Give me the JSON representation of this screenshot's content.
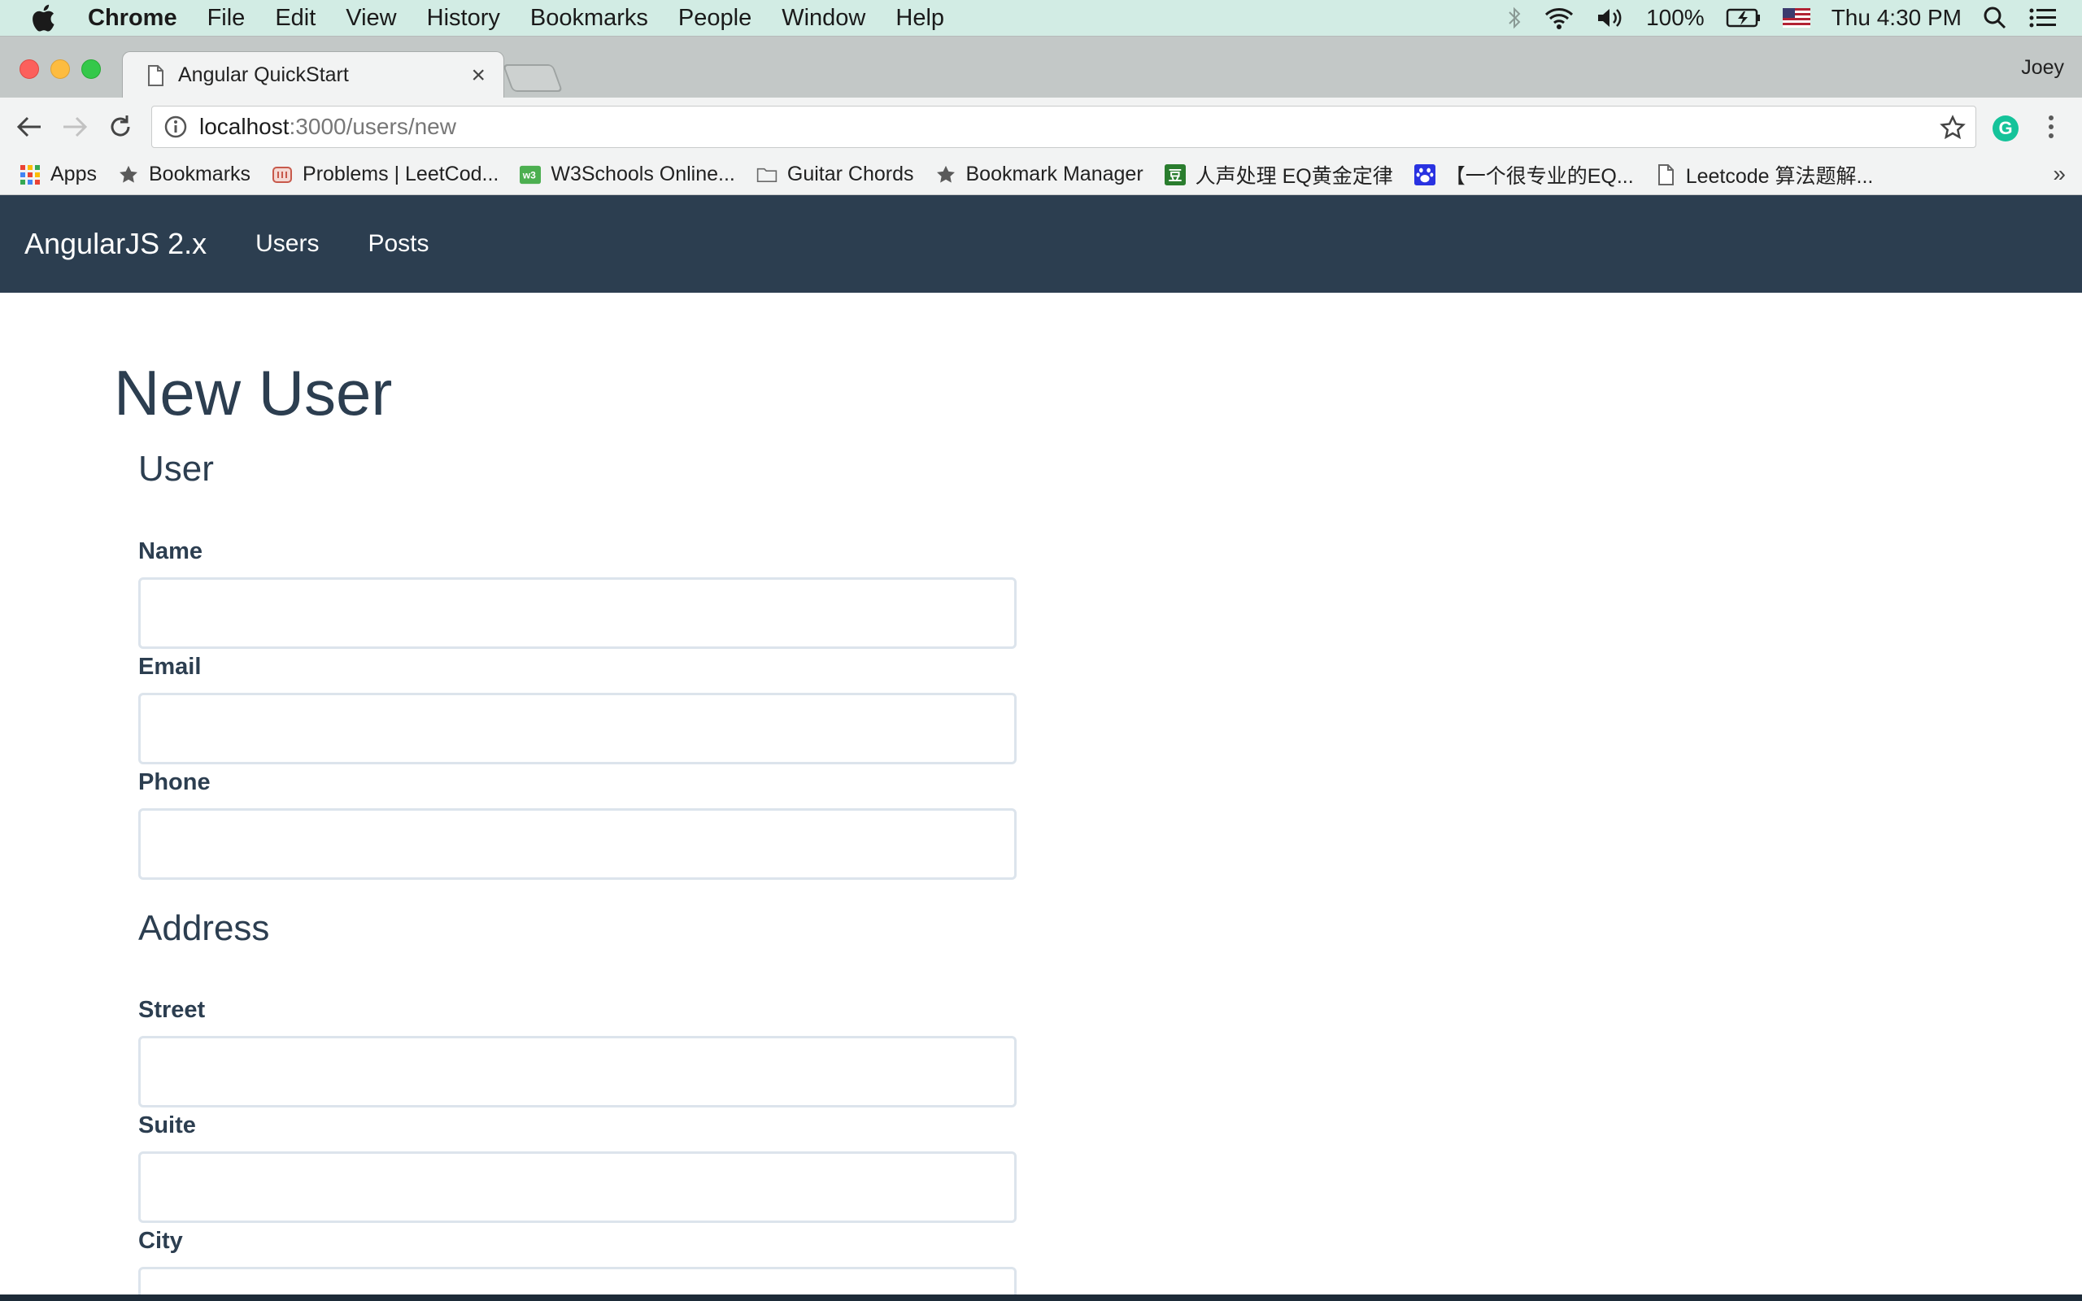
{
  "menubar": {
    "app_name": "Chrome",
    "items": [
      "File",
      "Edit",
      "View",
      "History",
      "Bookmarks",
      "People",
      "Window",
      "Help"
    ],
    "battery": "100%",
    "clock": "Thu 4:30 PM"
  },
  "browser": {
    "tab_title": "Angular QuickStart",
    "tab_close": "×",
    "profile_name": "Joey",
    "url_host": "localhost",
    "url_path": ":3000/users/new",
    "extension_letter": "G"
  },
  "bookmarks": {
    "items": [
      {
        "label": "Apps",
        "icon": "apps-grid-icon"
      },
      {
        "label": "Bookmarks",
        "icon": "star-icon"
      },
      {
        "label": "Problems | LeetCod...",
        "icon": "leetcode-icon"
      },
      {
        "label": "W3Schools Online...",
        "icon": "w3schools-icon"
      },
      {
        "label": "Guitar Chords",
        "icon": "folder-icon"
      },
      {
        "label": "Bookmark Manager",
        "icon": "star-icon"
      },
      {
        "label": "人声处理 EQ黄金定律",
        "icon": "douban-icon"
      },
      {
        "label": "【一个很专业的EQ...",
        "icon": "baidu-paw-icon"
      },
      {
        "label": "Leetcode 算法题解...",
        "icon": "page-icon"
      }
    ],
    "overflow": "»"
  },
  "navbar": {
    "brand": "AngularJS 2.x",
    "links": [
      "Users",
      "Posts"
    ]
  },
  "form": {
    "page_title": "New User",
    "user_section": "User",
    "address_section": "Address",
    "fields": {
      "name_label": "Name",
      "email_label": "Email",
      "phone_label": "Phone",
      "street_label": "Street",
      "suite_label": "Suite",
      "city_label": "City"
    },
    "values": {
      "name": "",
      "email": "",
      "phone": "",
      "street": "",
      "suite": "",
      "city": ""
    }
  },
  "colors": {
    "navbar_bg": "#2c3e50",
    "heading_text": "#2c3e50",
    "input_border": "#dce4ec",
    "menubar_bg": "#d2ece4"
  }
}
